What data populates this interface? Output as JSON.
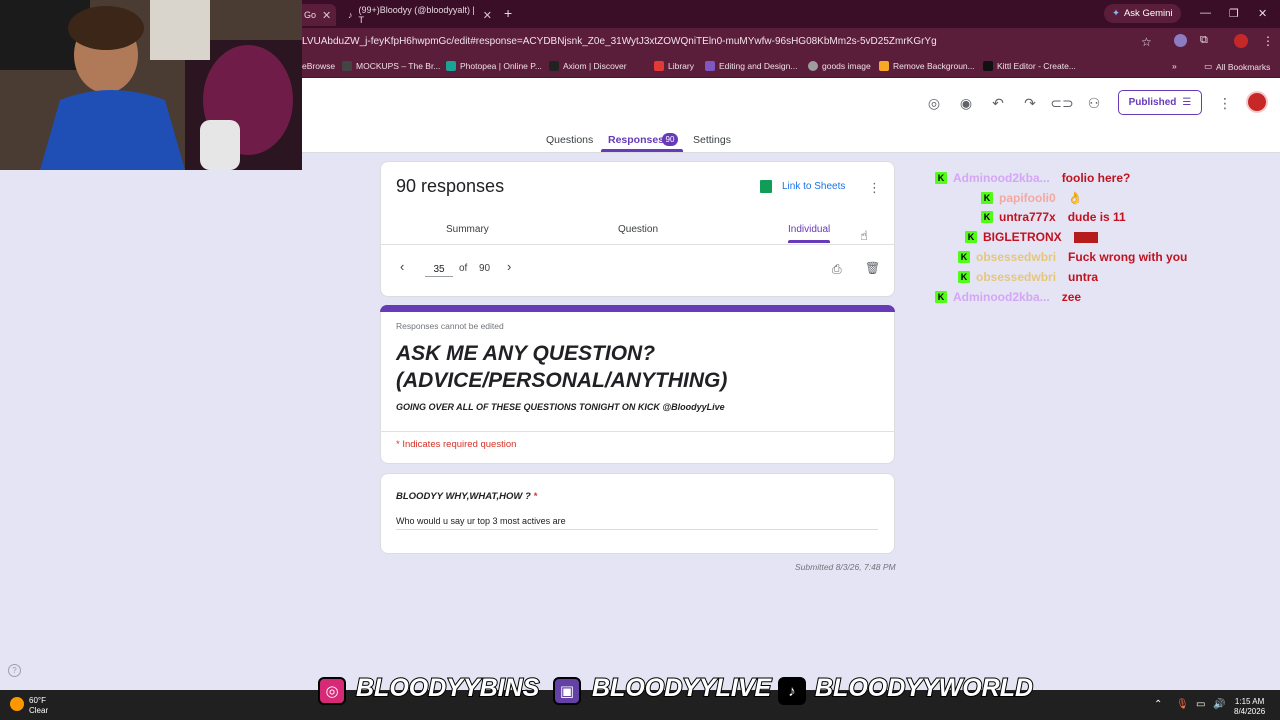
{
  "browser": {
    "tabs": [
      {
        "label": "Go"
      },
      {
        "label": "(99+)Bloodyy (@bloodyyalt) | T"
      }
    ],
    "url": "LVUAbduZW_j-feyKfpH6hwpmGc/edit#response=ACYDBNjsnk_Z0e_31WytJ3xtZOWQniTEln0-muMYwfw-96sHG08KbMm2s-5vD25ZmrKGrYg",
    "ask_gemini": "Ask Gemini",
    "bookmarks": [
      {
        "label": "eBrowse",
        "color": "#5a1e3b"
      },
      {
        "label": "MOCKUPS – The Br...",
        "color": "#444444"
      },
      {
        "label": "Photopea | Online P...",
        "color": "#18a497"
      },
      {
        "label": "Axiom | Discover",
        "color": "#222222"
      },
      {
        "label": "Library",
        "color": "#e53935"
      },
      {
        "label": "Editing and Design...",
        "color": "#7e57c2"
      },
      {
        "label": "goods image",
        "color": "#9e9e9e"
      },
      {
        "label": "Remove Backgroun...",
        "color": "#f9a825"
      },
      {
        "label": "Kittl Editor - Create...",
        "color": "#111111"
      }
    ],
    "all_bookmarks": "All Bookmarks"
  },
  "header": {
    "published_label": "Published"
  },
  "nav": {
    "tabs": [
      {
        "label": "Questions"
      },
      {
        "label": "Responses",
        "badge": "90"
      },
      {
        "label": "Settings"
      }
    ]
  },
  "responses": {
    "count_label": "90 responses",
    "link_to_sheets": "Link to Sheets",
    "subtabs": [
      {
        "label": "Summary"
      },
      {
        "label": "Question"
      },
      {
        "label": "Individual"
      }
    ],
    "current": "35",
    "of_label": "of",
    "total": "90"
  },
  "form": {
    "notice": "Responses cannot be edited",
    "title_line1": "ASK ME ANY QUESTION?",
    "title_line2": "(ADVICE/PERSONAL/ANYTHING)",
    "description": "GOING OVER ALL OF THESE QUESTIONS TONIGHT ON KICK @BloodyyLive",
    "required_note": "* Indicates required question",
    "question": "BLOODYY WHY,WHAT,HOW ?",
    "required_star": "*",
    "answer": "Who would u say ur top 3 most actives are",
    "submitted": "Submitted 8/3/26, 7:48 PM"
  },
  "chat": {
    "messages": [
      {
        "user": "Adminood2kba...",
        "text": "foolio here?",
        "user_color": "#d5a6f5"
      },
      {
        "user": "papifooli0",
        "text": "👌",
        "user_color": "#f4a9a0"
      },
      {
        "user": "untra777x",
        "text": "dude is 11",
        "user_color": "#c1121f"
      },
      {
        "user": "BIGLETRONX",
        "text": "",
        "user_color": "#c1121f"
      },
      {
        "user": "obsessedwbri",
        "text": "Fuck wrong with you",
        "user_color": "#e6c77a"
      },
      {
        "user": "obsessedwbri",
        "text": "untra",
        "user_color": "#e6c77a"
      },
      {
        "user": "Adminood2kba...",
        "text": "zee",
        "user_color": "#d5a6f5"
      }
    ],
    "badge_letter": "K"
  },
  "overlay": {
    "handle1": "BLOODYYBINS",
    "handle2": "BLOODYYLIVE",
    "handle3": "BLOODYYWORLD"
  },
  "taskbar": {
    "temp": "60°F",
    "weather": "Clear",
    "time": "1:15 AM",
    "date": "8/4/2026"
  }
}
